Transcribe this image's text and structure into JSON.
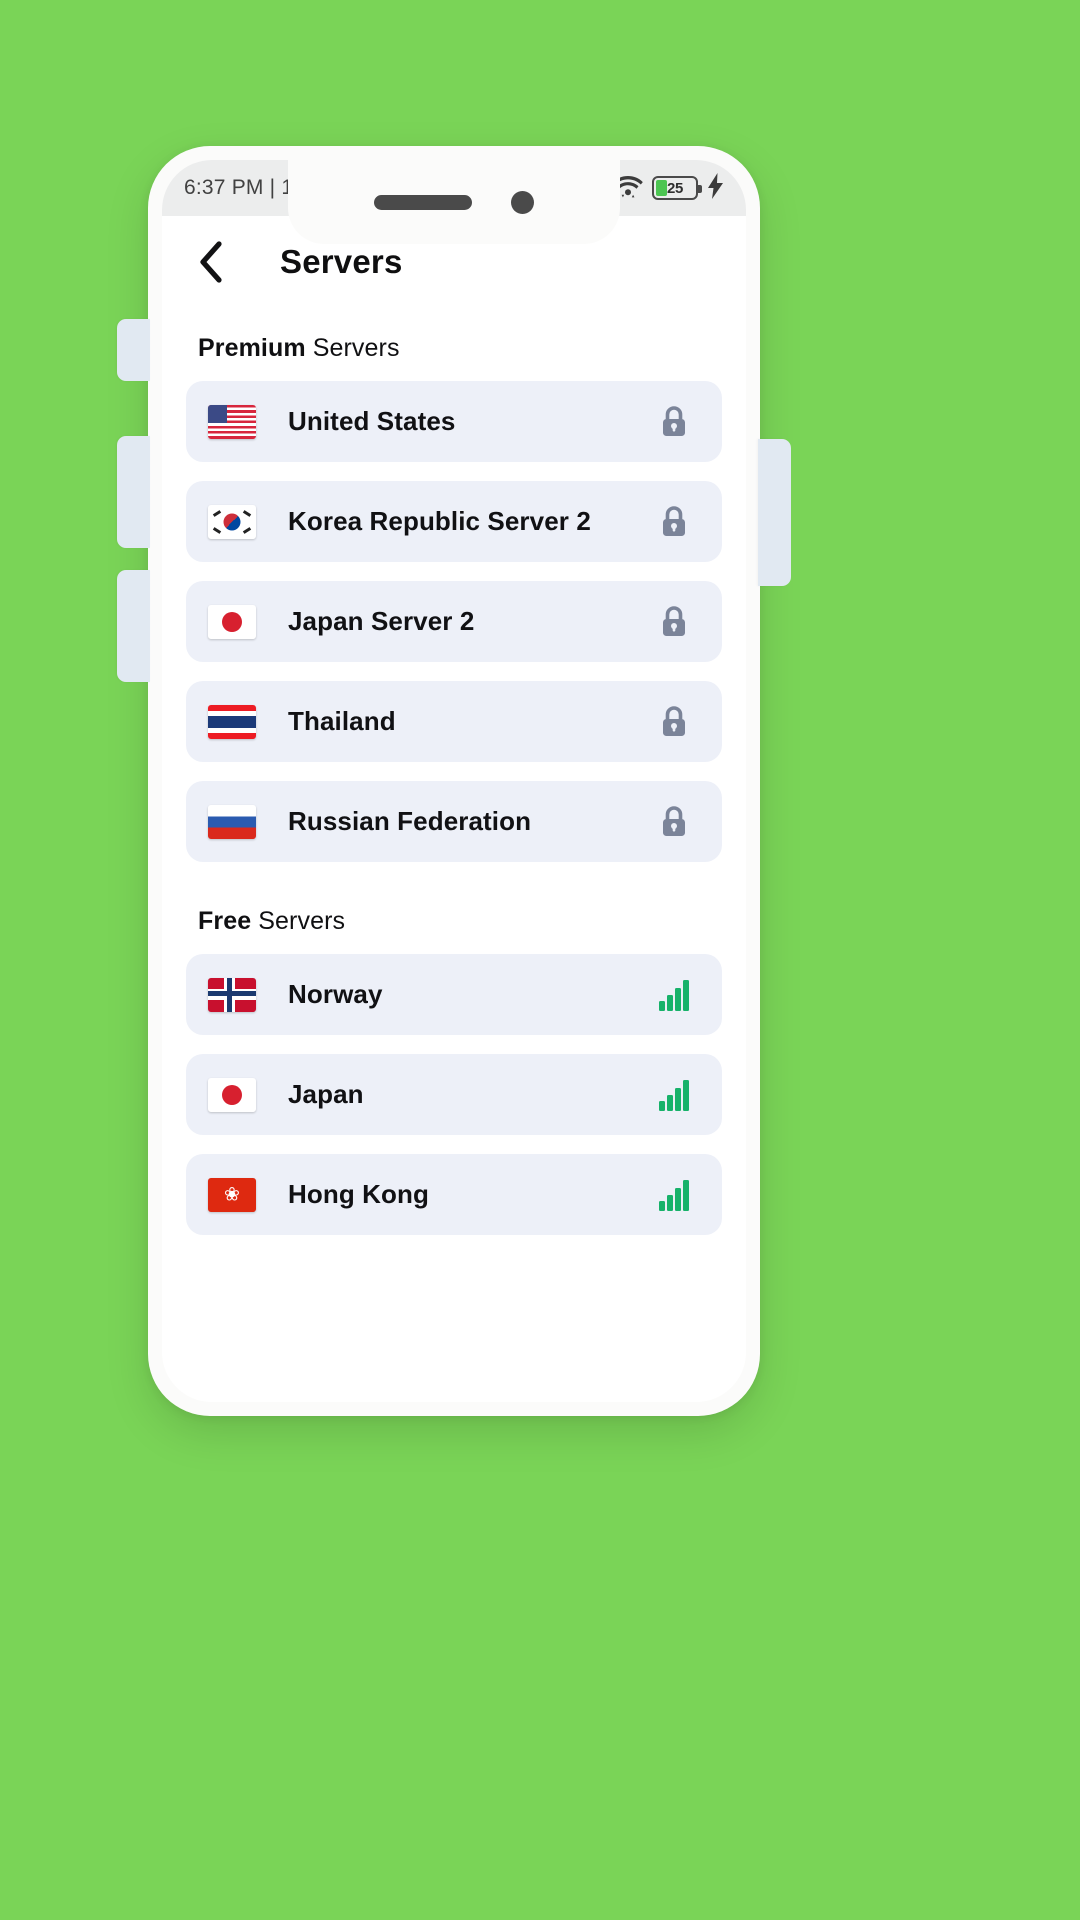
{
  "background_color": "#7AD457",
  "status_bar": {
    "time": "6:37 PM | 1",
    "wifi_icon": "wifi-icon",
    "battery_level": "25",
    "battery_fill_color": "#4CC552",
    "charging_icon": "charging-bolt-icon"
  },
  "header": {
    "back_icon": "back-chevron-icon",
    "title": "Servers"
  },
  "sections": [
    {
      "id": "premium",
      "label_strong": "Premium",
      "label_light": " Servers",
      "rows": [
        {
          "name": "United States",
          "flag": "flag-us",
          "status_icon": "lock-icon"
        },
        {
          "name": "Korea Republic Server 2",
          "flag": "flag-kr",
          "status_icon": "lock-icon"
        },
        {
          "name": "Japan Server 2",
          "flag": "flag-jp",
          "status_icon": "lock-icon"
        },
        {
          "name": "Thailand",
          "flag": "flag-th",
          "status_icon": "lock-icon"
        },
        {
          "name": "Russian Federation",
          "flag": "flag-ru",
          "status_icon": "lock-icon"
        }
      ]
    },
    {
      "id": "free",
      "label_strong": "Free",
      "label_light": " Servers",
      "rows": [
        {
          "name": "Norway",
          "flag": "flag-no",
          "status_icon": "signal-bars-icon"
        },
        {
          "name": "Japan",
          "flag": "flag-jp",
          "status_icon": "signal-bars-icon"
        },
        {
          "name": "Hong Kong",
          "flag": "flag-hk",
          "status_icon": "signal-bars-icon"
        }
      ]
    }
  ],
  "colors": {
    "card": "#EDF0F8",
    "lock": "#7B8499",
    "signal": "#17B26A",
    "text": "#111114"
  },
  "device": {
    "buttons": [
      "mute-switch",
      "volume-up-button",
      "volume-down-button",
      "power-button"
    ],
    "notch": [
      "speaker-grille",
      "front-camera"
    ]
  }
}
